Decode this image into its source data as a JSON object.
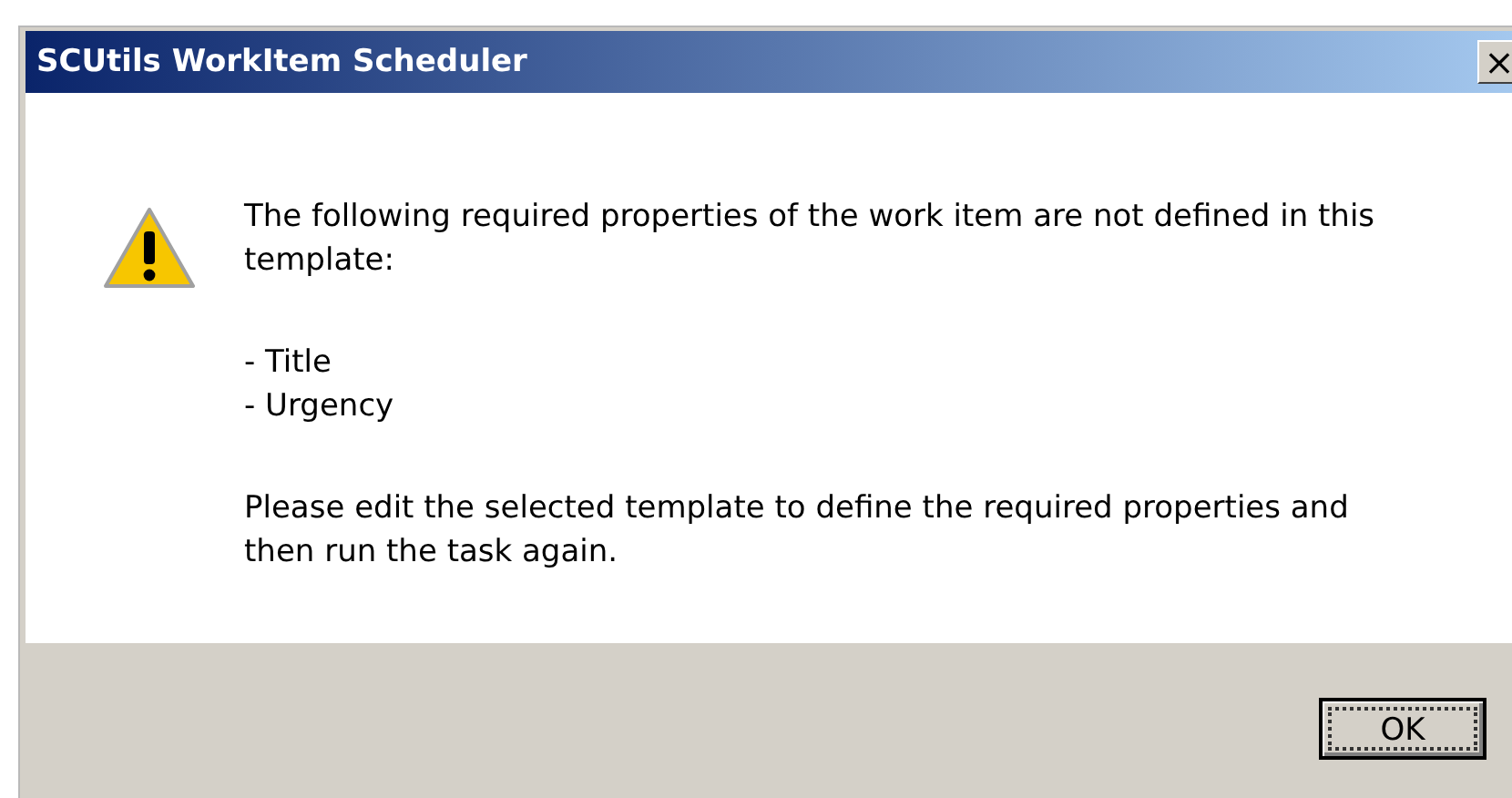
{
  "window": {
    "title": "SCUtils WorkItem Scheduler",
    "close": "×"
  },
  "message": {
    "lines": [
      "The following required properties of the work item are not defined in this template:"
    ],
    "items": [
      "- Title",
      "- Urgency"
    ],
    "footer": "Please edit the selected template to define the required properties and then run the task again."
  },
  "buttons": [
    {
      "label": "OK",
      "focused": true
    }
  ]
}
